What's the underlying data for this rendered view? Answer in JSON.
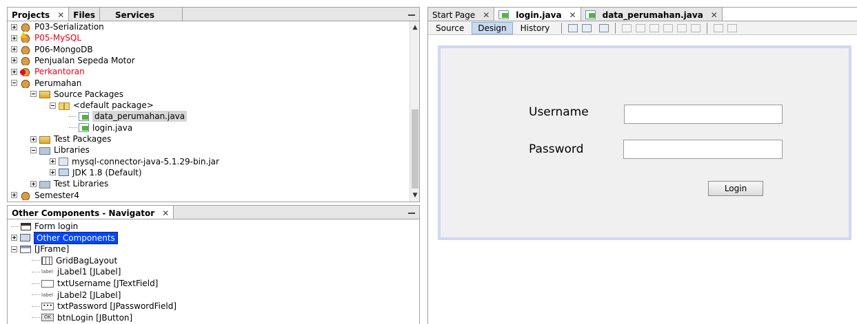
{
  "projects_panel": {
    "tabs": [
      {
        "label": "Projects"
      },
      {
        "label": "Files"
      },
      {
        "label": "Services"
      }
    ],
    "close_glyph": "✕",
    "tree": [
      {
        "label": "P03-Serialization",
        "level": 0,
        "expanded": false,
        "icon": "project-icon"
      },
      {
        "label": "P05-MySQL",
        "level": 0,
        "expanded": false,
        "icon": "project-warning-icon",
        "color": "#e8001c"
      },
      {
        "label": "P06-MongoDB",
        "level": 0,
        "expanded": false,
        "icon": "project-icon"
      },
      {
        "label": "Penjualan Sepeda Motor",
        "level": 0,
        "expanded": false,
        "icon": "project-icon"
      },
      {
        "label": "Perkantoran",
        "level": 0,
        "expanded": false,
        "icon": "project-error-icon",
        "color": "#e8001c"
      },
      {
        "label": "Perumahan",
        "level": 0,
        "expanded": true,
        "icon": "project-icon"
      },
      {
        "label": "Source Packages",
        "level": 1,
        "expanded": true,
        "icon": "source-folder-icon"
      },
      {
        "label": "<default package>",
        "level": 2,
        "expanded": true,
        "icon": "package-icon"
      },
      {
        "label": "data_perumahan.java",
        "level": 3,
        "icon": "java-form-icon",
        "selected": true
      },
      {
        "label": "login.java",
        "level": 3,
        "icon": "java-form-icon"
      },
      {
        "label": "Test Packages",
        "level": 1,
        "expanded": false,
        "icon": "test-folder-icon"
      },
      {
        "label": "Libraries",
        "level": 1,
        "expanded": true,
        "icon": "libraries-icon"
      },
      {
        "label": "mysql-connector-java-5.1.29-bin.jar",
        "level": 2,
        "expanded": false,
        "icon": "jar-icon"
      },
      {
        "label": "JDK 1.8 (Default)",
        "level": 2,
        "expanded": false,
        "icon": "jdk-icon"
      },
      {
        "label": "Test Libraries",
        "level": 1,
        "expanded": false,
        "icon": "libraries-icon"
      },
      {
        "label": "Semester4",
        "level": 0,
        "expanded": false,
        "icon": "project-icon"
      }
    ]
  },
  "navigator_panel": {
    "tab_label": "Other Components - Navigator",
    "close_glyph": "✕",
    "tree": [
      {
        "label": "Form login",
        "level": 0,
        "icon": "form-icon"
      },
      {
        "label": "Other Components",
        "level": 0,
        "expanded": false,
        "icon": "other-components-icon",
        "selected": true
      },
      {
        "label": "[JFrame]",
        "level": 0,
        "expanded": true,
        "icon": "jframe-icon"
      },
      {
        "label": "GridBagLayout",
        "level": 1,
        "icon": "gridbag-icon"
      },
      {
        "label": "jLabel1 [JLabel]",
        "level": 1,
        "icon": "label-icon"
      },
      {
        "label": "txtUsername [JTextField]",
        "level": 1,
        "icon": "textfield-icon"
      },
      {
        "label": "jLabel2 [JLabel]",
        "level": 1,
        "icon": "label-icon"
      },
      {
        "label": "txtPassword [JPasswordField]",
        "level": 1,
        "icon": "passwordfield-icon"
      },
      {
        "label": "btnLogin [JButton]",
        "level": 1,
        "icon": "button-icon"
      }
    ],
    "icon_text": {
      "label": "label",
      "ok": "OK",
      "pass": "•••"
    }
  },
  "editor": {
    "tabs": [
      {
        "label": "Start Page",
        "bold": false,
        "icon": ""
      },
      {
        "label": "login.java",
        "bold": true,
        "icon": "java-form-icon",
        "active": true
      },
      {
        "label": "data_perumahan.java",
        "bold": true,
        "icon": "java-form-icon"
      }
    ],
    "close_glyph": "✕",
    "view_buttons": [
      {
        "label": "Source"
      },
      {
        "label": "Design",
        "active": true
      },
      {
        "label": "History"
      }
    ],
    "form": {
      "username_label": "Username",
      "password_label": "Password",
      "username_value": "",
      "password_value": "",
      "login_button": "Login"
    }
  },
  "colors": {
    "error_text": "#e8001c",
    "selection_blue": "#0046ff",
    "design_border": "#d0d8f4"
  }
}
